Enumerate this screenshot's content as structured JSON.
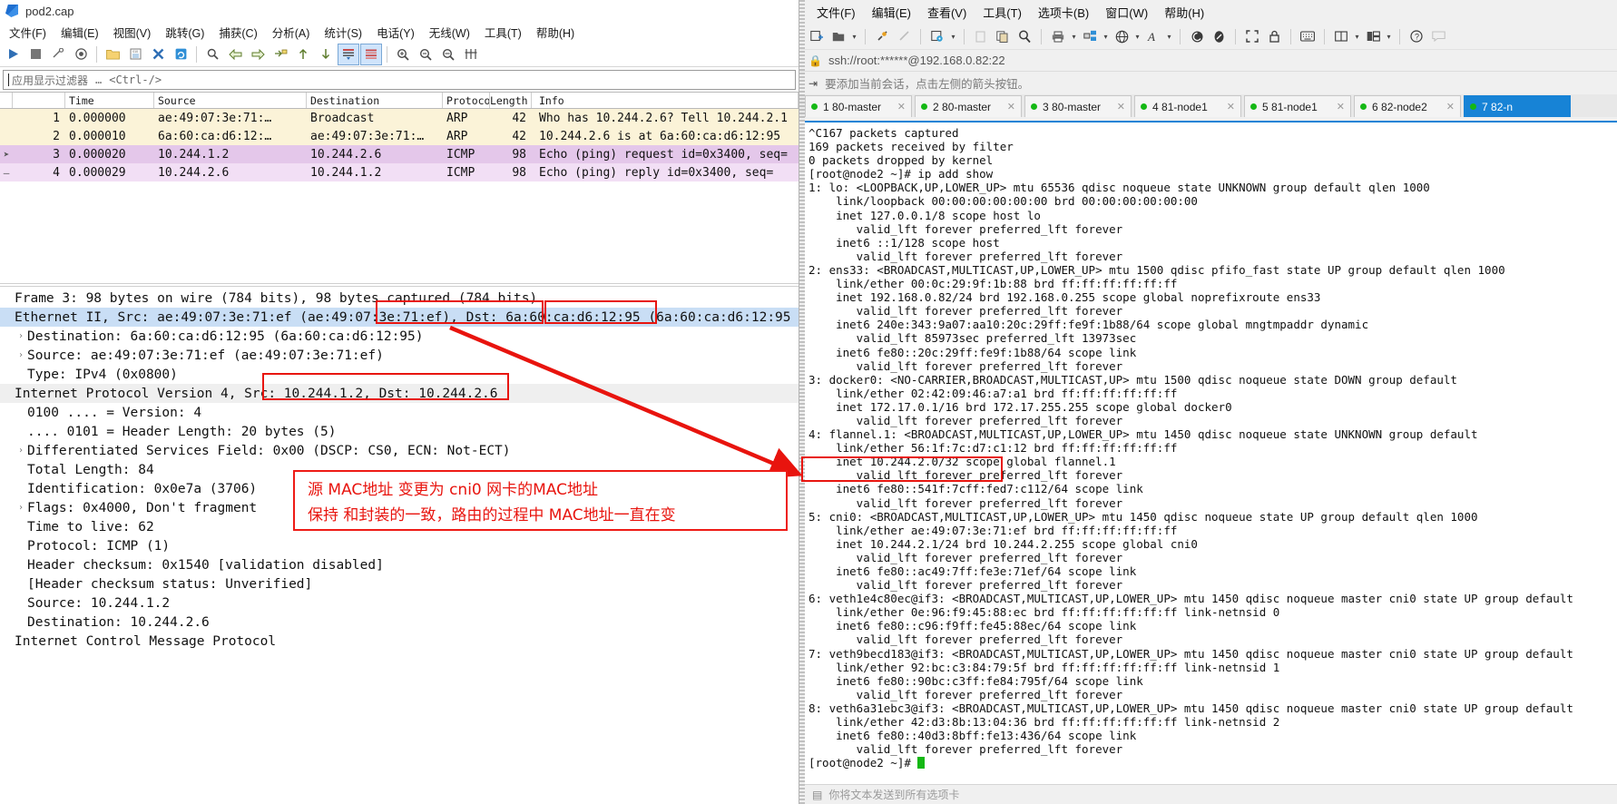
{
  "wireshark": {
    "title": "pod2.cap",
    "menu": [
      "文件(F)",
      "编辑(E)",
      "视图(V)",
      "跳转(G)",
      "捕获(C)",
      "分析(A)",
      "统计(S)",
      "电话(Y)",
      "无线(W)",
      "工具(T)",
      "帮助(H)"
    ],
    "filter": {
      "placeholder": "应用显示过滤器",
      "dots": "…",
      "shortcut": "<Ctrl-/>"
    },
    "packet_list": {
      "columns": [
        "",
        "Time",
        "Source",
        "Destination",
        "Protocol",
        "Length",
        "Info"
      ],
      "rows": [
        {
          "no": "1",
          "time": "0.000000",
          "source": "ae:49:07:3e:71:…",
          "destination": "Broadcast",
          "protocol": "ARP",
          "length": "42",
          "info": "Who has 10.244.2.6? Tell 10.244.2.1"
        },
        {
          "no": "2",
          "time": "0.000010",
          "source": "6a:60:ca:d6:12:…",
          "destination": "ae:49:07:3e:71:…",
          "protocol": "ARP",
          "length": "42",
          "info": "10.244.2.6 is at 6a:60:ca:d6:12:95"
        },
        {
          "no": "3",
          "time": "0.000020",
          "source": "10.244.1.2",
          "destination": "10.244.2.6",
          "protocol": "ICMP",
          "length": "98",
          "info": "Echo (ping) request  id=0x3400, seq="
        },
        {
          "no": "4",
          "time": "0.000029",
          "source": "10.244.2.6",
          "destination": "10.244.1.2",
          "protocol": "ICMP",
          "length": "98",
          "info": "Echo (ping) reply    id=0x3400, seq="
        }
      ]
    },
    "detail": [
      "Frame 3: 98 bytes on wire (784 bits), 98 bytes captured (784 bits)",
      "Ethernet II, Src: ae:49:07:3e:71:ef (ae:49:07:3e:71:ef), Dst: 6a:60:ca:d6:12:95 (6a:60:ca:d6:12:95",
      "Destination: 6a:60:ca:d6:12:95 (6a:60:ca:d6:12:95)",
      "Source: ae:49:07:3e:71:ef (ae:49:07:3e:71:ef)",
      "Type: IPv4 (0x0800)",
      "Internet Protocol Version 4, Src: 10.244.1.2, Dst: 10.244.2.6",
      "0100 .... = Version: 4",
      ".... 0101 = Header Length: 20 bytes (5)",
      "Differentiated Services Field: 0x00 (DSCP: CS0, ECN: Not-ECT)",
      "Total Length: 84",
      "Identification: 0x0e7a (3706)",
      "Flags: 0x4000, Don't fragment",
      "Time to live: 62",
      "Protocol: ICMP (1)",
      "Header checksum: 0x1540 [validation disabled]",
      "[Header checksum status: Unverified]",
      "Source: 10.244.1.2",
      "Destination: 10.244.2.6",
      "Internet Control Message Protocol"
    ]
  },
  "annotation": {
    "line1": "源 MAC地址 变更为 cni0 网卡的MAC地址",
    "line2": "保持 和封装的一致，路由的过程中 MAC地址一直在变",
    "color": "#e8140e"
  },
  "xshell": {
    "menu": [
      "文件(F)",
      "编辑(E)",
      "查看(V)",
      "工具(T)",
      "选项卡(B)",
      "窗口(W)",
      "帮助(H)"
    ],
    "address": "ssh://root:******@192.168.0.82:22",
    "hint": "要添加当前会话，点击左侧的箭头按钮。",
    "tabs": [
      {
        "index": "1",
        "label": "80-master",
        "active": false
      },
      {
        "index": "2",
        "label": "80-master",
        "active": false
      },
      {
        "index": "3",
        "label": "80-master",
        "active": false
      },
      {
        "index": "4",
        "label": "81-node1",
        "active": false
      },
      {
        "index": "5",
        "label": "81-node1",
        "active": false
      },
      {
        "index": "6",
        "label": "82-node2",
        "active": false
      },
      {
        "index": "7",
        "label": "82-n",
        "active": true
      }
    ],
    "terminal": "^C167 packets captured\n169 packets received by filter\n0 packets dropped by kernel\n[root@node2 ~]# ip add show\n1: lo: <LOOPBACK,UP,LOWER_UP> mtu 65536 qdisc noqueue state UNKNOWN group default qlen 1000\n    link/loopback 00:00:00:00:00:00 brd 00:00:00:00:00:00\n    inet 127.0.0.1/8 scope host lo\n       valid_lft forever preferred_lft forever\n    inet6 ::1/128 scope host\n       valid_lft forever preferred_lft forever\n2: ens33: <BROADCAST,MULTICAST,UP,LOWER_UP> mtu 1500 qdisc pfifo_fast state UP group default qlen 1000\n    link/ether 00:0c:29:9f:1b:88 brd ff:ff:ff:ff:ff:ff\n    inet 192.168.0.82/24 brd 192.168.0.255 scope global noprefixroute ens33\n       valid_lft forever preferred_lft forever\n    inet6 240e:343:9a07:aa10:20c:29ff:fe9f:1b88/64 scope global mngtmpaddr dynamic\n       valid_lft 85973sec preferred_lft 13973sec\n    inet6 fe80::20c:29ff:fe9f:1b88/64 scope link\n       valid_lft forever preferred_lft forever\n3: docker0: <NO-CARRIER,BROADCAST,MULTICAST,UP> mtu 1500 qdisc noqueue state DOWN group default\n    link/ether 02:42:09:46:a7:a1 brd ff:ff:ff:ff:ff:ff\n    inet 172.17.0.1/16 brd 172.17.255.255 scope global docker0\n       valid_lft forever preferred_lft forever\n4: flannel.1: <BROADCAST,MULTICAST,UP,LOWER_UP> mtu 1450 qdisc noqueue state UNKNOWN group default\n    link/ether 56:1f:7c:d7:c1:12 brd ff:ff:ff:ff:ff:ff\n    inet 10.244.2.0/32 scope global flannel.1\n       valid_lft forever preferred_lft forever\n    inet6 fe80::541f:7cff:fed7:c112/64 scope link\n       valid_lft forever preferred_lft forever\n5: cni0: <BROADCAST,MULTICAST,UP,LOWER_UP> mtu 1450 qdisc noqueue state UP group default qlen 1000\n    link/ether ae:49:07:3e:71:ef brd ff:ff:ff:ff:ff:ff\n    inet 10.244.2.1/24 brd 10.244.2.255 scope global cni0\n       valid_lft forever preferred_lft forever\n    inet6 fe80::ac49:7ff:fe3e:71ef/64 scope link\n       valid_lft forever preferred_lft forever\n6: veth1e4c80ec@if3: <BROADCAST,MULTICAST,UP,LOWER_UP> mtu 1450 qdisc noqueue master cni0 state UP group default\n    link/ether 0e:96:f9:45:88:ec brd ff:ff:ff:ff:ff:ff link-netnsid 0\n    inet6 fe80::c96:f9ff:fe45:88ec/64 scope link\n       valid_lft forever preferred_lft forever\n7: veth9becd183@if3: <BROADCAST,MULTICAST,UP,LOWER_UP> mtu 1450 qdisc noqueue master cni0 state UP group default\n    link/ether 92:bc:c3:84:79:5f brd ff:ff:ff:ff:ff:ff link-netnsid 1\n    inet6 fe80::90bc:c3ff:fe84:795f/64 scope link\n       valid_lft forever preferred_lft forever\n8: veth6a31ebc3@if3: <BROADCAST,MULTICAST,UP,LOWER_UP> mtu 1450 qdisc noqueue master cni0 state UP group default\n    link/ether 42:d3:8b:13:04:36 brd ff:ff:ff:ff:ff:ff link-netnsid 2\n    inet6 fe80::40d3:8bff:fe13:436/64 scope link\n       valid_lft forever preferred_lft forever\n[root@node2 ~]# ",
    "status": "你将文本发送到所有选项卡"
  }
}
